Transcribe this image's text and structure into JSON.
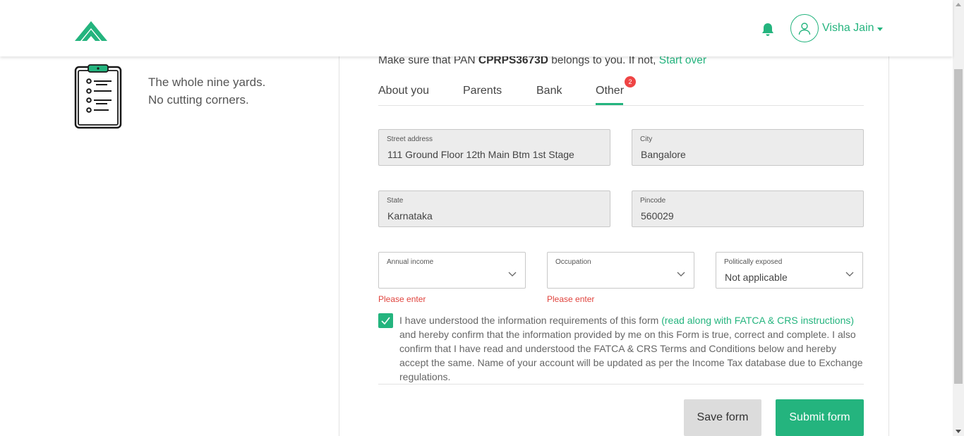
{
  "header": {
    "user_name": "Visha Jain",
    "accent_color": "#24b47e",
    "icons": [
      "logo-icon",
      "bell-icon",
      "user-icon",
      "caret-down-icon"
    ]
  },
  "left": {
    "tagline_line1": "The whole nine yards.",
    "tagline_line2": "No cutting corners."
  },
  "pan": {
    "prefix": "Make sure that PAN",
    "number": "CPRPS3673D",
    "middle": "belongs to you. If not,",
    "link": "Start over"
  },
  "tabs": [
    {
      "label": "About you"
    },
    {
      "label": "Parents"
    },
    {
      "label": "Bank"
    },
    {
      "label": "Other",
      "badge": "2",
      "active": true
    }
  ],
  "fields": {
    "street": {
      "label": "Street address",
      "value": "111 Ground Floor 12th Main Btm 1st Stage"
    },
    "city": {
      "label": "City",
      "value": "Bangalore"
    },
    "state": {
      "label": "State",
      "value": "Karnataka"
    },
    "pincode": {
      "label": "Pincode",
      "value": "560029"
    },
    "income": {
      "label": "Annual income",
      "value": "",
      "error": "Please enter"
    },
    "occupation": {
      "label": "Occupation",
      "value": "",
      "error": "Please enter"
    },
    "politically_exposed": {
      "label": "Politically exposed",
      "value": "Not applicable"
    }
  },
  "consent": {
    "checked": true,
    "text_before": "I have understood the information requirements of this form",
    "link": "(read along with FATCA & CRS instructions)",
    "text_after": "and hereby confirm that the information provided by me on this Form is true, correct and complete. I also confirm that I have read and understood the FATCA & CRS Terms and Conditions below and hereby accept the same. Name of your account will be updated as per the Income Tax database due to Exchange regulations."
  },
  "buttons": {
    "save": "Save form",
    "submit": "Submit form"
  },
  "colors": {
    "accent": "#24b47e",
    "error": "#e0443e",
    "badge": "#ef4444"
  }
}
